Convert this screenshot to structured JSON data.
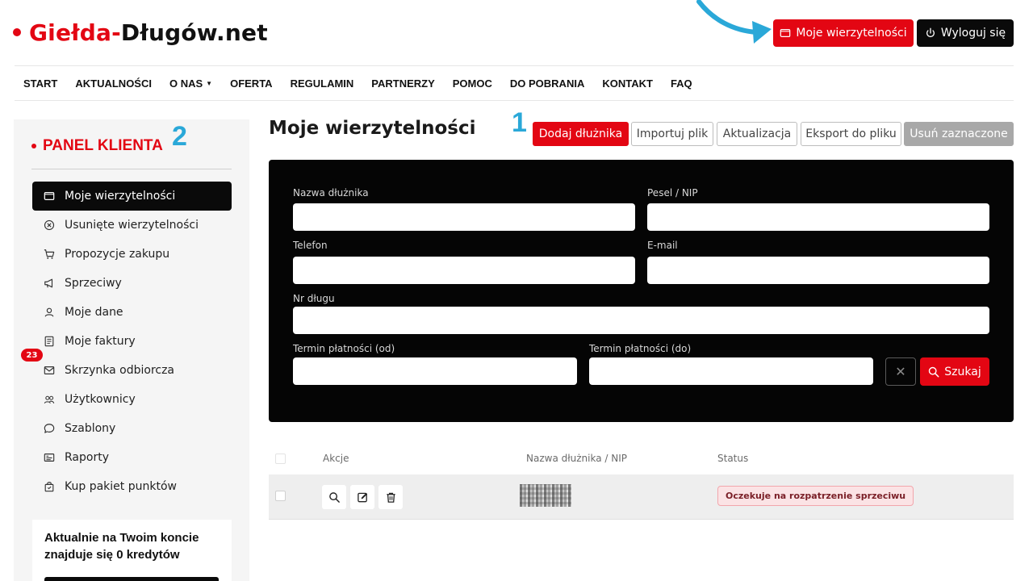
{
  "logo": {
    "part1": "Giełda-",
    "part2": "Długów.net"
  },
  "header": {
    "my_claims_btn": "Moje wierzytelności",
    "logout_btn": "Wyloguj się",
    "accent_color": "#e30613"
  },
  "nav": {
    "items": [
      "START",
      "AKTUALNOŚCI",
      "O NAS",
      "OFERTA",
      "REGULAMIN",
      "PARTNERZY",
      "POMOC",
      "DO POBRANIA",
      "KONTAKT",
      "FAQ"
    ]
  },
  "sidebar": {
    "title": "PANEL KLIENTA",
    "marker": "2",
    "items": [
      {
        "label": "Moje wierzytelności",
        "icon": "folder-icon"
      },
      {
        "label": "Usunięte wierzytelności",
        "icon": "x-circle-icon"
      },
      {
        "label": "Propozycje zakupu",
        "icon": "cart-icon"
      },
      {
        "label": "Sprzeciwy",
        "icon": "megaphone-icon"
      },
      {
        "label": "Moje dane",
        "icon": "user-icon"
      },
      {
        "label": "Moje faktury",
        "icon": "invoice-icon"
      },
      {
        "label": "Skrzynka odbiorcza",
        "icon": "mail-icon"
      },
      {
        "label": "Użytkownicy",
        "icon": "users-icon"
      },
      {
        "label": "Szablony",
        "icon": "chat-icon"
      },
      {
        "label": "Raporty",
        "icon": "report-icon"
      },
      {
        "label": "Kup pakiet punktów",
        "icon": "bag-icon"
      }
    ],
    "inbox_badge": "23",
    "credits_text": "Aktualnie na Twoim koncie znajduje się 0 kredytów"
  },
  "main": {
    "title": "Moje wierzytelności",
    "marker": "1",
    "toolbar": {
      "add": "Dodaj dłużnika",
      "import": "Importuj plik",
      "update": "Aktualizacja",
      "export": "Eksport do pliku",
      "delete": "Usuń zaznaczone"
    }
  },
  "filters": {
    "debtor_name": "Nazwa dłużnika",
    "pesel_nip": "Pesel / NIP",
    "phone": "Telefon",
    "email": "E-mail",
    "debt_no": "Nr długu",
    "due_from": "Termin płatności (od)",
    "due_to": "Termin płatności (do)",
    "search_btn": "Szukaj"
  },
  "table": {
    "headers": {
      "actions": "Akcje",
      "name_nip": "Nazwa dłużnika / NIP",
      "status": "Status"
    },
    "rows": [
      {
        "status": "Oczekuje na rozpatrzenie sprzeciwu"
      }
    ]
  }
}
